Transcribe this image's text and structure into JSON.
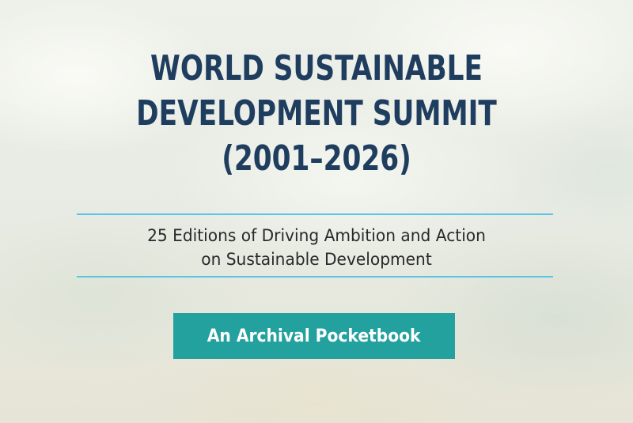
{
  "cover": {
    "title_lines": [
      "WORLD SUSTAINABLE",
      "DEVELOPMENT SUMMIT",
      "(2001–2026)"
    ],
    "subtitle_lines": [
      "25 Editions of Driving Ambition and Action",
      "on Sustainable Development"
    ],
    "badge_label": "An Archival Pocketbook"
  },
  "colors": {
    "title": "#1f3d5e",
    "rule": "#5cc3e8",
    "badge_background": "#23a19f",
    "badge_text": "#ffffff",
    "subtitle": "#27292c"
  }
}
